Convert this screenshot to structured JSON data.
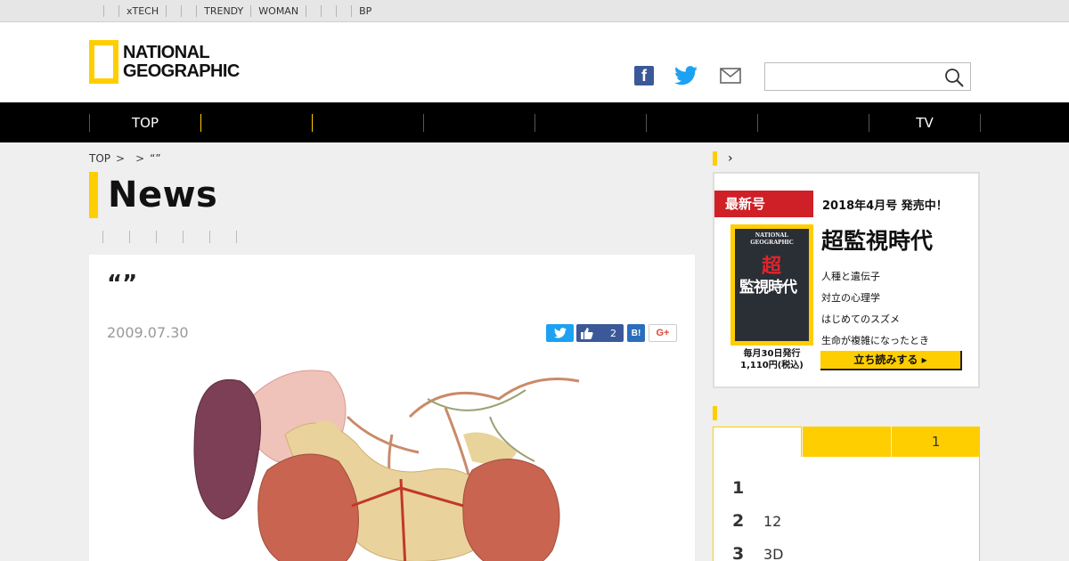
{
  "netbar": {
    "items": [
      "",
      "xTECH",
      "",
      "",
      "TRENDY",
      "WOMAN",
      "",
      "",
      "",
      "BP"
    ]
  },
  "header": {
    "logo_line1": "NATIONAL",
    "logo_line2": "GEOGRAPHIC",
    "brand_color": "#ffce00",
    "search_placeholder": ""
  },
  "gnav": {
    "items": [
      "TOP",
      "",
      "",
      "",
      "",
      "",
      "",
      "TV"
    ]
  },
  "breadcrumb": {
    "home": "TOP",
    "sep1": ">",
    "sep2": ">",
    "current": "“”"
  },
  "section": {
    "title": "News"
  },
  "article": {
    "title": "“”",
    "date": "2009.07.30",
    "share": {
      "twitter_icon": "twitter-icon",
      "like_count": "2",
      "hatena": "B!",
      "gplus": "G+"
    }
  },
  "sidebar": {
    "magazine": {
      "label": "最新号",
      "issue": "2018年4月号 発売中！",
      "cover_logo_line1": "NATIONAL",
      "cover_logo_line2": "GEOGRAPHIC",
      "cover_big1": "超",
      "cover_big2": "監視時代",
      "release_line1": "毎月30日発行",
      "release_line2": "1,110円(税込)",
      "feature": "超監視時代",
      "topics": [
        "人種と遺伝子",
        "対立の心理学",
        "はじめてのスズメ",
        "生命が複雑になったとき"
      ],
      "read_button": "立ち読みする ▸"
    },
    "ranking": {
      "tabs": [
        "",
        "",
        "1"
      ],
      "rows": [
        {
          "num": "1",
          "text": ""
        },
        {
          "num": "2",
          "text": "12"
        },
        {
          "num": "3",
          "text": "3D"
        }
      ]
    }
  }
}
